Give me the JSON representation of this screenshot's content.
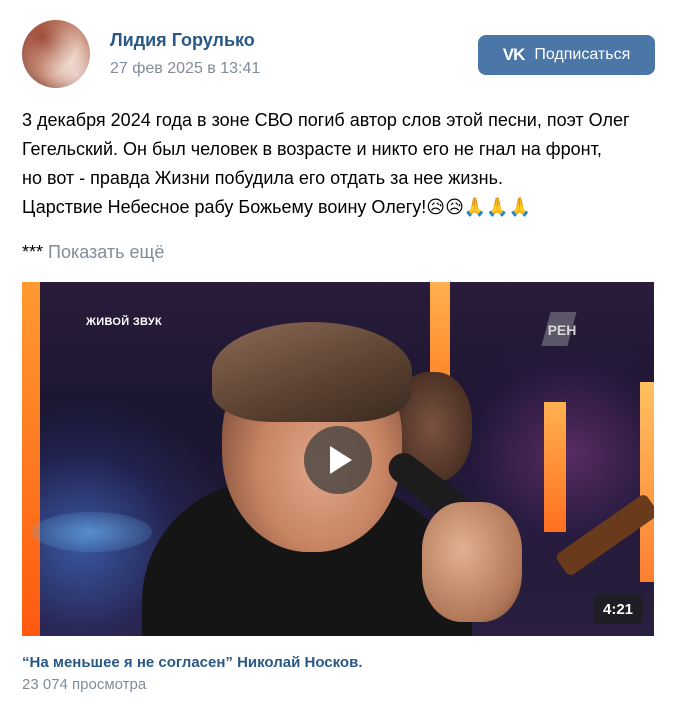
{
  "post": {
    "author": "Лидия Горулько",
    "date": "27 фев 2025 в 13:41",
    "subscribe_label": "Подписаться",
    "subscribe_icon": "vk-logo-icon",
    "subscribe_icon_text": "VK",
    "text_lines": [
      "3 декабря 2024 года в зоне СВО погиб автор слов этой песни, поэт Олег",
      "Гегельский. Он был человек в возрасте и никто его не гнал на фронт,",
      "но вот - правда Жизни побудила его отдать за нее жизнь.",
      "Царствие Небесное рабу Божьему воину Олегу!😥😥🙏🙏🙏"
    ],
    "more_prefix": "***",
    "more_label": "Показать ещё"
  },
  "video": {
    "overlay_label": "ЖИВОЙ ЗВУК",
    "channel_logo": "РЕН",
    "duration": "4:21",
    "title": "“На меньшее я не согласен” Николай Носков.",
    "views": "23 074 просмотра"
  },
  "colors": {
    "link": "#2a5885",
    "muted": "#818c99",
    "button": "#4a76a8"
  }
}
